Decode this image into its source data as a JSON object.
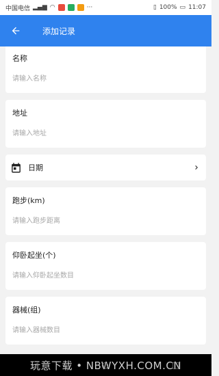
{
  "status_bar": {
    "carrier": "中国电信",
    "battery": "100%",
    "time": "11:07"
  },
  "app_bar": {
    "title": "添加记录",
    "back_icon": "arrow-back-icon"
  },
  "form": {
    "name": {
      "label": "名称",
      "placeholder": "请输入名称"
    },
    "address": {
      "label": "地址",
      "placeholder": "请输入地址"
    },
    "date": {
      "label": "日期",
      "icon": "calendar-icon"
    },
    "running": {
      "label": "跑步(km)",
      "placeholder": "请输入跑步距离"
    },
    "situps": {
      "label": "仰卧起坐(个)",
      "placeholder": "请输入仰卧起坐数目"
    },
    "equipment": {
      "label": "器械(组)",
      "placeholder": "请输入器械数目"
    }
  },
  "watermark": "玩意下载 • NBWYXH.COM.CN",
  "colors": {
    "primary": "#2f82ee",
    "background": "#f2f2f2"
  }
}
